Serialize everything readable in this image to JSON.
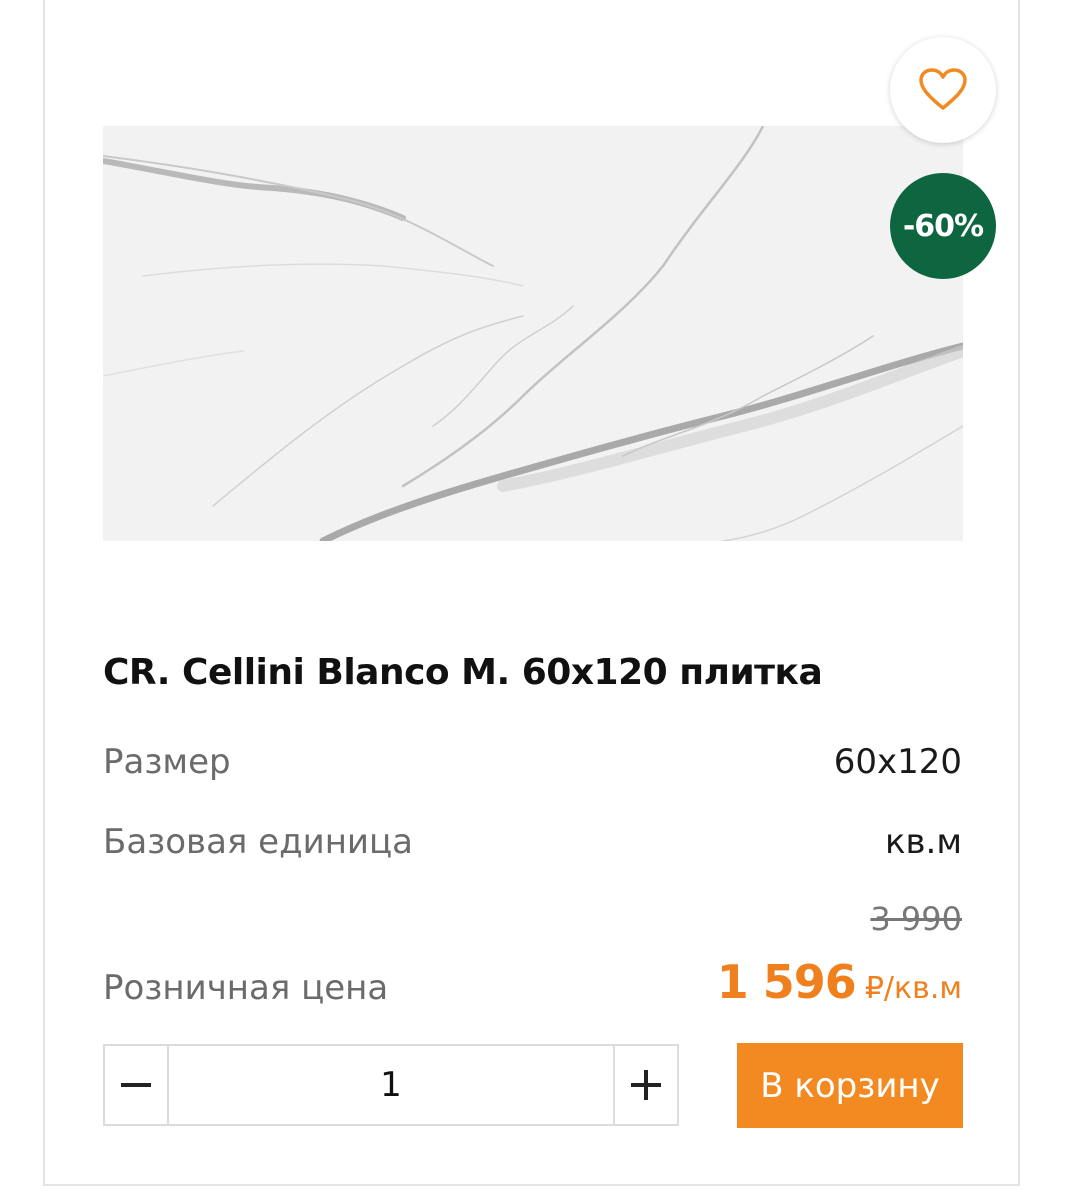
{
  "product": {
    "title": "CR. Cellini Blanco M. 60x120 плитка",
    "discount": "-60%",
    "image_alt": "marble-tile-image"
  },
  "specs": [
    {
      "label": "Размер",
      "value": "60x120"
    },
    {
      "label": "Базовая единица",
      "value": "кв.м"
    }
  ],
  "price": {
    "label": "Розничная цена",
    "old": "3 990",
    "current": "1 596",
    "unit": "₽/кв.м"
  },
  "quantity": {
    "value": "1",
    "minus_icon": "minus-icon",
    "plus_icon": "plus-icon"
  },
  "actions": {
    "add_to_cart": "В корзину",
    "favorite_icon": "heart-icon"
  },
  "colors": {
    "accent": "#f28a21",
    "price": "#f07f1e",
    "badge": "#0e6640"
  }
}
